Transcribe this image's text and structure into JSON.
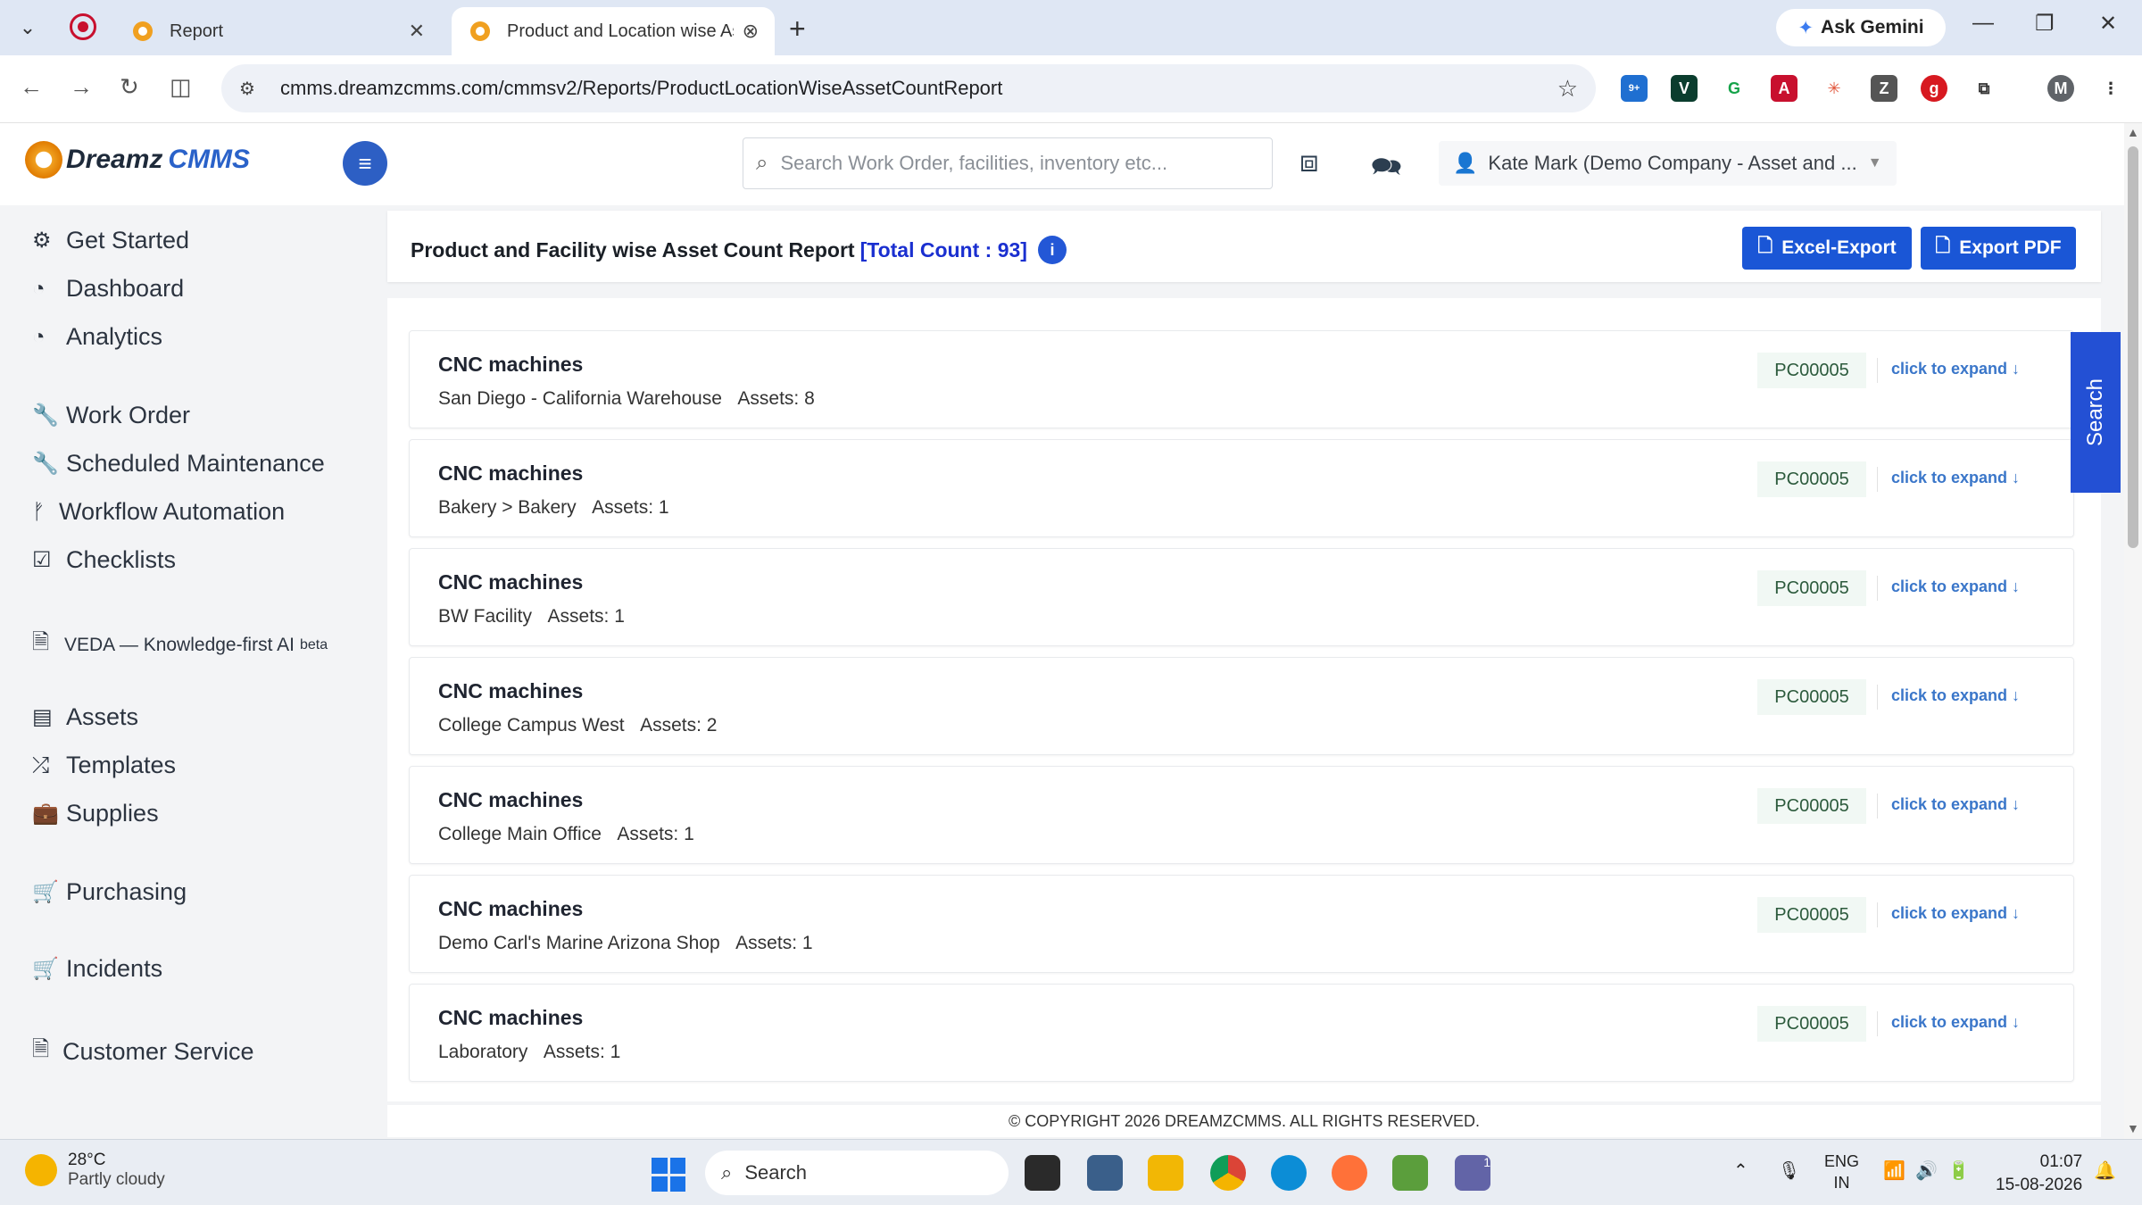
{
  "browser": {
    "tabs": [
      {
        "title": "Report",
        "active": false
      },
      {
        "title": "Product and Location wise Asse",
        "active": true
      }
    ],
    "ask_gemini": "Ask Gemini",
    "url": "cmms.dreamzcmms.com/cmmsv2/Reports/ProductLocationWiseAssetCountReport",
    "ext_badge": "9+"
  },
  "header": {
    "logo_dreamz": "Dreamz",
    "logo_cmms": "CMMS",
    "search_placeholder": "Search Work Order, facilities, inventory etc...",
    "user": "Kate Mark (Demo Company - Asset and ..."
  },
  "sidebar": {
    "items": [
      {
        "label": "Get Started",
        "icon": "gears-icon"
      },
      {
        "label": "Dashboard",
        "icon": "dashboard-icon"
      },
      {
        "label": "Analytics",
        "icon": "analytics-icon"
      },
      {
        "label": "Work Order",
        "icon": "wrench-icon"
      },
      {
        "label": "Scheduled Maintenance",
        "icon": "wrench-icon"
      },
      {
        "label": "Workflow Automation",
        "icon": "branch-icon"
      },
      {
        "label": "Checklists",
        "icon": "checkbox-icon"
      },
      {
        "label": "VEDA — Knowledge-first AI",
        "badge": "beta",
        "icon": "document-icon"
      },
      {
        "label": "Assets",
        "icon": "archive-icon"
      },
      {
        "label": "Templates",
        "icon": "shuffle-icon"
      },
      {
        "label": "Supplies",
        "icon": "briefcase-icon"
      },
      {
        "label": "Purchasing",
        "icon": "cart-icon"
      },
      {
        "label": "Incidents",
        "icon": "cart-icon"
      },
      {
        "label": "Customer Service",
        "icon": "document-icon"
      }
    ]
  },
  "report": {
    "title": "Product and Facility wise Asset Count Report",
    "total_count": "[Total Count : 93]",
    "excel_export": "Excel-Export",
    "export_pdf": "Export PDF",
    "search_tab": "Search",
    "rows": [
      {
        "name": "CNC machines",
        "location": "San Diego - California Warehouse",
        "assets": "Assets: 8",
        "code": "PC00005",
        "expand": "click to expand ↓"
      },
      {
        "name": "CNC machines",
        "location": "Bakery > Bakery",
        "assets": "Assets: 1",
        "code": "PC00005",
        "expand": "click to expand ↓"
      },
      {
        "name": "CNC machines",
        "location": "BW Facility",
        "assets": "Assets: 1",
        "code": "PC00005",
        "expand": "click to expand ↓"
      },
      {
        "name": "CNC machines",
        "location": "College Campus West",
        "assets": "Assets: 2",
        "code": "PC00005",
        "expand": "click to expand ↓"
      },
      {
        "name": "CNC machines",
        "location": "College Main Office",
        "assets": "Assets: 1",
        "code": "PC00005",
        "expand": "click to expand ↓"
      },
      {
        "name": "CNC machines",
        "location": "Demo Carl's Marine Arizona Shop",
        "assets": "Assets: 1",
        "code": "PC00005",
        "expand": "click to expand ↓"
      },
      {
        "name": "CNC machines",
        "location": "Laboratory",
        "assets": "Assets: 1",
        "code": "PC00005",
        "expand": "click to expand ↓"
      }
    ],
    "footer": "© COPYRIGHT 2026 DREAMZCMMS. ALL RIGHTS RESERVED."
  },
  "taskbar": {
    "temp": "28°C",
    "weather": "Partly cloudy",
    "search": "Search",
    "lang1": "ENG",
    "lang2": "IN",
    "time": "01:07",
    "date": "15-08-2026",
    "teams_badge": "1"
  }
}
